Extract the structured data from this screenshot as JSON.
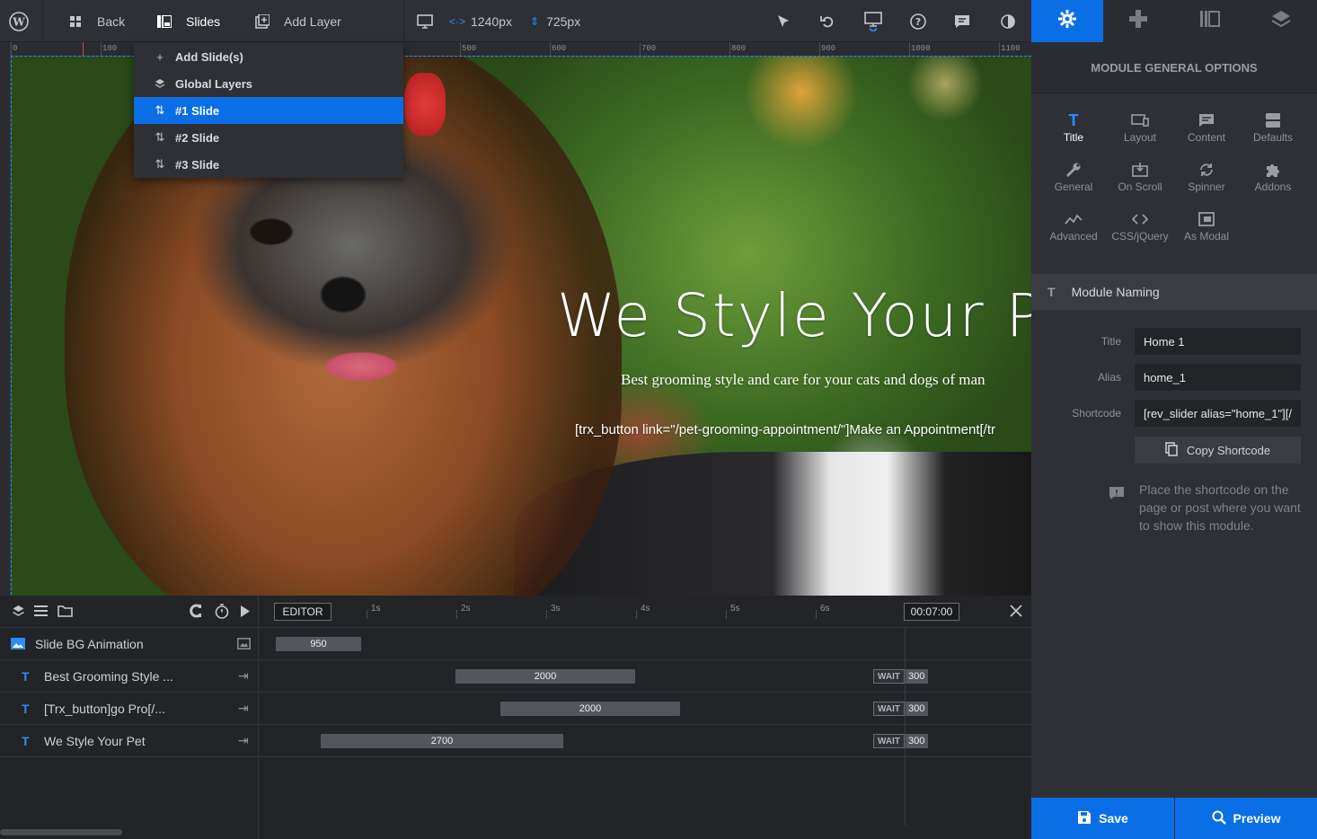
{
  "toolbar": {
    "back_label": "Back",
    "slides_label": "Slides",
    "add_layer_label": "Add Layer",
    "width_value": "1240px",
    "height_value": "725px"
  },
  "ruler": {
    "marks": [
      "0",
      "100",
      "500",
      "600",
      "700",
      "800",
      "900",
      "1000",
      "1100"
    ]
  },
  "slides_menu": {
    "items": [
      {
        "label": "Add Slide(s)",
        "icon": "plus-icon"
      },
      {
        "label": "Global Layers",
        "icon": "layers-icon"
      },
      {
        "label": "#1 Slide",
        "icon": "sort-icon",
        "active": true
      },
      {
        "label": "#2 Slide",
        "icon": "sort-icon"
      },
      {
        "label": "#3 Slide",
        "icon": "sort-icon"
      }
    ]
  },
  "canvas": {
    "title_text": "We Style Your P",
    "subtitle_text": "Best grooming style and care for your cats and dogs of man",
    "shortcode_text": "[trx_button link=\"/pet-grooming-appointment/\"]Make an Appointment[/tr"
  },
  "timeline": {
    "editor_label": "EDITOR",
    "time_value": "00:07:00",
    "scale": [
      "1s",
      "2s",
      "3s",
      "4s",
      "5s",
      "6s"
    ],
    "rows": [
      {
        "label": "Slide BG Animation",
        "bar_value": "950"
      },
      {
        "label": "Best Grooming Style ...",
        "bar_value": "2000",
        "wait_label": "WAIT",
        "wait_value": "300"
      },
      {
        "label": "[Trx_button]go Pro[/...",
        "bar_value": "2000",
        "wait_label": "WAIT",
        "wait_value": "300"
      },
      {
        "label": "We Style Your Pet",
        "bar_value": "2700",
        "wait_label": "WAIT",
        "wait_value": "300"
      }
    ]
  },
  "panel": {
    "heading": "MODULE GENERAL OPTIONS",
    "options": [
      {
        "label": "Title",
        "icon": "title-t-icon",
        "active": true
      },
      {
        "label": "Layout",
        "icon": "layout-icon"
      },
      {
        "label": "Content",
        "icon": "content-icon"
      },
      {
        "label": "Defaults",
        "icon": "defaults-icon"
      },
      {
        "label": "General",
        "icon": "wrench-icon"
      },
      {
        "label": "On Scroll",
        "icon": "scroll-icon"
      },
      {
        "label": "Spinner",
        "icon": "spinner-icon"
      },
      {
        "label": "Addons",
        "icon": "puzzle-icon"
      },
      {
        "label": "Advanced",
        "icon": "chart-line-icon"
      },
      {
        "label": "CSS/jQuery",
        "icon": "code-icon"
      },
      {
        "label": "As Modal",
        "icon": "modal-icon"
      }
    ],
    "naming_title": "Module Naming",
    "fields": {
      "title_label": "Title",
      "title_value": "Home 1",
      "alias_label": "Alias",
      "alias_value": "home_1",
      "shortcode_label": "Shortcode",
      "shortcode_value": "[rev_slider alias=\"home_1\"][/"
    },
    "copy_label": "Copy Shortcode",
    "hint": "Place the shortcode on the page or post where you want to show this module.",
    "save_label": "Save",
    "preview_label": "Preview"
  },
  "colors": {
    "accent": "#0a6fe6",
    "panel_bg": "#2e3035",
    "timeline_bg": "#232428"
  }
}
